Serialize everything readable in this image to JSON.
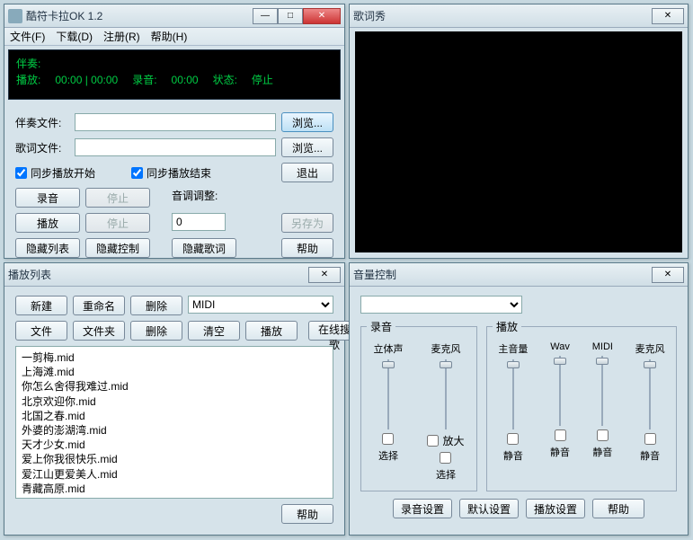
{
  "main": {
    "title": "酷符卡拉OK 1.2",
    "menu": {
      "file": "文件(F)",
      "download": "下载(D)",
      "register": "注册(R)",
      "help": "帮助(H)"
    },
    "display": {
      "accomp": "伴奏:",
      "play": "播放:",
      "play_time": "00:00 | 00:00",
      "record": "录音:",
      "record_time": "00:00",
      "status_lbl": "状态:",
      "status_val": "停止"
    },
    "labels": {
      "accomp_file": "伴奏文件:",
      "lyric_file": "歌词文件:",
      "pitch": "音调调整:"
    },
    "buttons": {
      "browse": "浏览...",
      "exit": "退出",
      "record": "录音",
      "stop": "停止",
      "play": "播放",
      "save_as": "另存为",
      "hide_list": "隐藏列表",
      "hide_ctrl": "隐藏控制",
      "hide_lyric": "隐藏歌词",
      "help": "帮助"
    },
    "checks": {
      "sync_start": "同步播放开始",
      "sync_end": "同步播放结束"
    },
    "pitch_val": "0"
  },
  "lyric_win": {
    "title": "歌词秀"
  },
  "playlist": {
    "title": "播放列表",
    "buttons": {
      "new": "新建",
      "rename": "重命名",
      "delete": "删除",
      "file": "文件",
      "folder": "文件夹",
      "delete2": "删除",
      "clear": "清空",
      "play": "播放",
      "online": "在线搜歌",
      "help": "帮助"
    },
    "combo": "MIDI",
    "items": [
      "一剪梅.mid",
      "上海滩.mid",
      "你怎么舍得我难过.mid",
      "北京欢迎你.mid",
      "北国之春.mid",
      "外婆的澎湖湾.mid",
      "天才少女.mid",
      "爱上你我很快乐.mid",
      "爱江山更爱美人.mid",
      "青藏高原.mid"
    ]
  },
  "volume": {
    "title": "音量控制",
    "groups": {
      "record": "录音",
      "play": "播放"
    },
    "cols": {
      "stereo": "立体声",
      "mic": "麦克风",
      "master": "主音量",
      "wav": "Wav",
      "midi": "MIDI",
      "mic2": "麦克风"
    },
    "labels": {
      "amplify": "放大",
      "select": "选择",
      "mute": "静音"
    },
    "buttons": {
      "rec_set": "录音设置",
      "def_set": "默认设置",
      "play_set": "播放设置",
      "help": "帮助"
    }
  }
}
